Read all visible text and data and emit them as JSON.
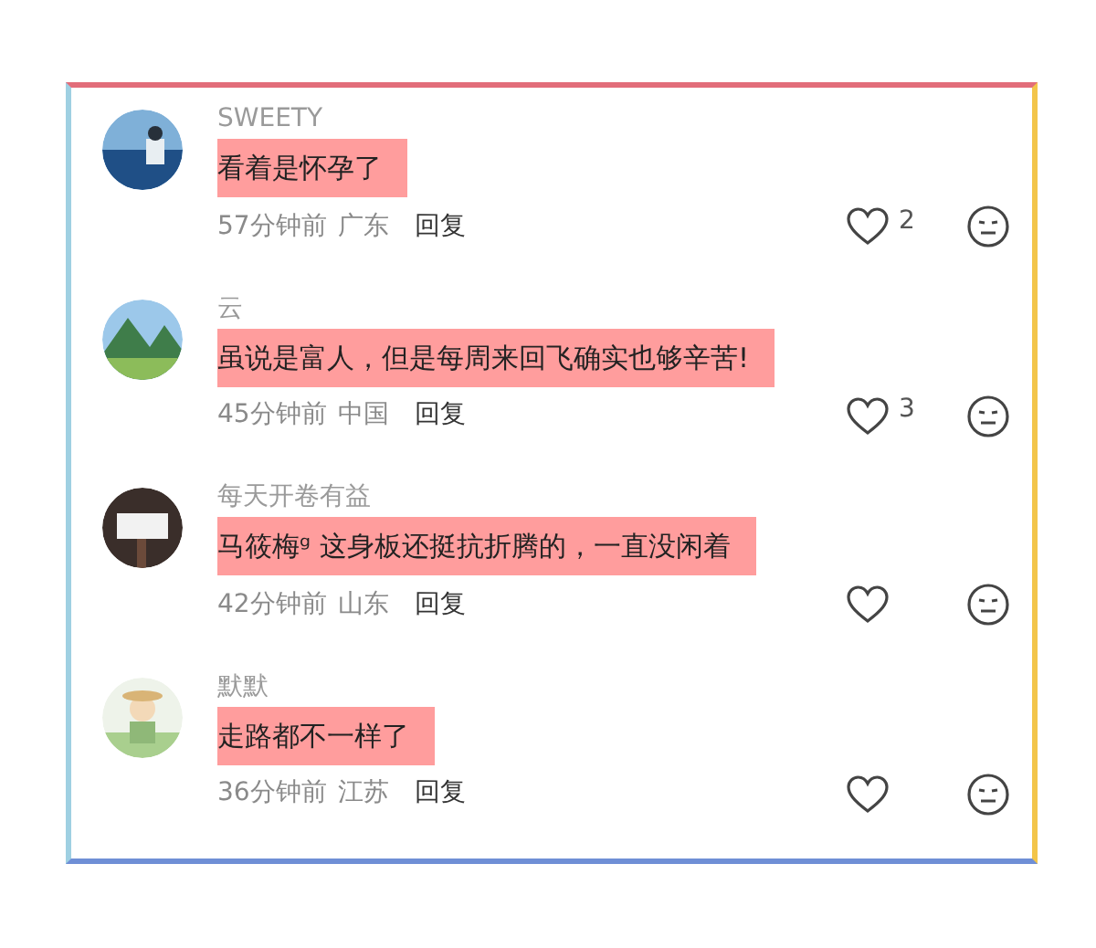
{
  "comments": [
    {
      "user": "SWEETY",
      "text": "看着是怀孕了",
      "highlighted": true,
      "time": "57分钟前",
      "region": "广东",
      "reply": "回复",
      "likes": "2"
    },
    {
      "user": "云",
      "text": "虽说是富人，但是每周来回飞确实也够辛苦!",
      "highlighted": true,
      "time": "45分钟前",
      "region": "中国",
      "reply": "回复",
      "likes": "3"
    },
    {
      "user": "每天开卷有益",
      "text": "马筱梅ᵍ 这身板还挺抗折腾的，一直没闲着",
      "highlighted": true,
      "time": "42分钟前",
      "region": "山东",
      "reply": "回复"
    },
    {
      "user": "默默",
      "text": "走路都不一样了",
      "highlighted": true,
      "time": "36分钟前",
      "region": "江苏",
      "reply": "回复"
    }
  ]
}
